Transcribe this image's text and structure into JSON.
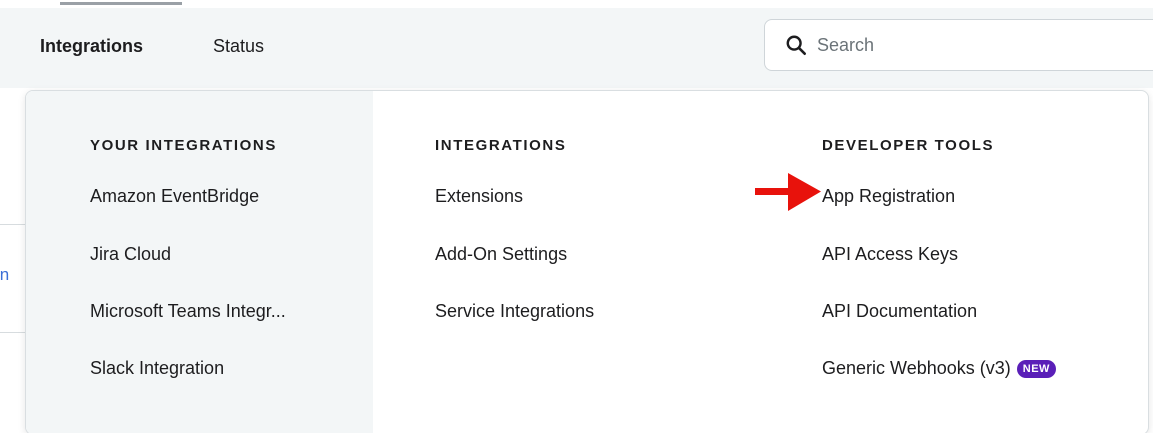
{
  "nav": {
    "items": [
      {
        "label": "Integrations",
        "active": true
      },
      {
        "label": "Status",
        "active": false
      }
    ]
  },
  "search": {
    "placeholder": "Search",
    "value": "",
    "icon": "search-icon"
  },
  "background": {
    "partial_link_text": "in"
  },
  "dropdown": {
    "columns": [
      {
        "heading": "YOUR INTEGRATIONS",
        "items": [
          "Amazon EventBridge",
          "Jira Cloud",
          "Microsoft Teams Integr...",
          "Slack Integration"
        ]
      },
      {
        "heading": "INTEGRATIONS",
        "items": [
          "Extensions",
          "Add-On Settings",
          "Service Integrations"
        ]
      },
      {
        "heading": "DEVELOPER TOOLS",
        "items": [
          "App Registration",
          "API Access Keys",
          "API Documentation",
          "Generic Webhooks (v3)"
        ],
        "badge": "NEW"
      }
    ]
  },
  "annotation": {
    "icon": "red-arrow-icon",
    "color": "#e8120c"
  },
  "colors": {
    "nav_bg": "#f3f6f7",
    "badge_bg": "#5a1fb8",
    "text": "#1d1d1f",
    "link": "#3b6fd6"
  }
}
